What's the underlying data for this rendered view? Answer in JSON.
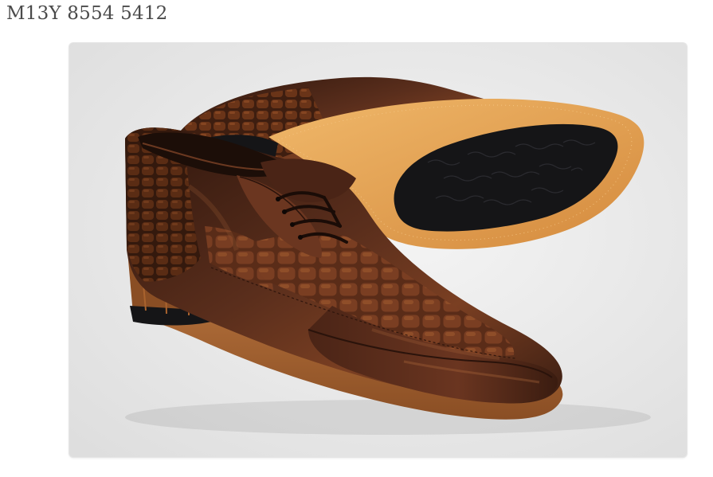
{
  "product": {
    "code": "M13Y 8554 5412"
  },
  "photo": {
    "subject": "brown-leather-lace-up-shoes",
    "colors": {
      "background": "#ececec",
      "leather_dark": "#3a1d12",
      "leather_mid": "#5a2e1c",
      "leather_light": "#8a4a2a",
      "sole_tan": "#e3a55a",
      "outsole_black": "#151517"
    }
  }
}
